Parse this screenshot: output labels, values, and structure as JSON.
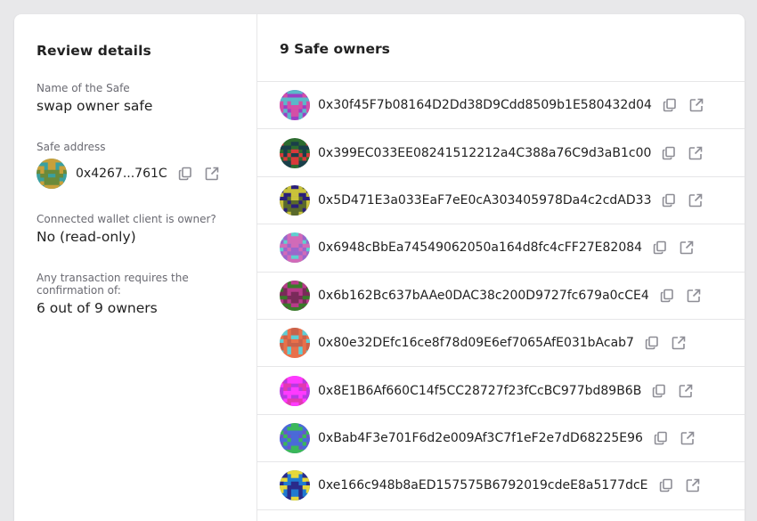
{
  "review": {
    "title": "Review details",
    "name_label": "Name of the Safe",
    "name_value": "swap owner safe",
    "address_label": "Safe address",
    "address_value": "0x4267...761C",
    "owner_label": "Connected wallet client is owner?",
    "owner_value": "No (read-only)",
    "confirm_label": "Any transaction requires the confirmation of:",
    "confirm_value": "6 out of 9 owners"
  },
  "owners": {
    "title": "9 Safe owners",
    "items": [
      {
        "address": "0x30f45F7b08164D2Dd38D9Cdd8509b1E580432d04",
        "bg": "#9b3fc4",
        "fg": "#5bb8c9",
        "fg2": "#d44fa6"
      },
      {
        "address": "0x399EC033EE08241512212a4C388a76C9d3aB1c00",
        "bg": "#2d6b2f",
        "fg": "#d83a3a",
        "fg2": "#1a3f4a"
      },
      {
        "address": "0x5D471E3a033EaF7eE0cA303405978Da4c2cdAD33",
        "bg": "#2a1f7a",
        "fg": "#c9c23a",
        "fg2": "#5a6a2a"
      },
      {
        "address": "0x6948cBbEa74549062050a164d8fc4cFF27E82084",
        "bg": "#5fd0d0",
        "fg": "#d26ab8",
        "fg2": "#9b66cc"
      },
      {
        "address": "0x6b162Bc637bAAe0DAC38c200D9727fc679a0cCE4",
        "bg": "#3a7a2a",
        "fg": "#b83a8a",
        "fg2": "#7a2a5a"
      },
      {
        "address": "0x80e32DEfc16ce8f78d09E6ef7065AfE031bAcab7",
        "bg": "#e9704a",
        "fg": "#5ccfd6",
        "fg2": "#c9624a"
      },
      {
        "address": "0x8E1B6Af660C14f5CC28727f23fCcBC977bd89B6B",
        "bg": "#b63ae0",
        "fg": "#e03ab0",
        "fg2": "#ff3aff"
      },
      {
        "address": "0xBab4F3e701F6d2e009Af3C7f1eF2e7dD68225E96",
        "bg": "#6a56c8",
        "fg": "#3ab85a",
        "fg2": "#4a6ad8"
      },
      {
        "address": "0xe166c948b8aED157575B6792019cdeE8a5177dcE",
        "bg": "#1f7ad0",
        "fg": "#e6d83a",
        "fg2": "#2a2a8a"
      }
    ]
  },
  "safe_avatar": {
    "bg": "#3aa0a0",
    "fg": "#c9a03a",
    "fg2": "#6a8a3a"
  },
  "icons": {
    "copy": "copy-icon",
    "external": "external-link-icon"
  },
  "colors": {
    "icon": "#8e8e96",
    "divider": "#e6e6e8"
  }
}
